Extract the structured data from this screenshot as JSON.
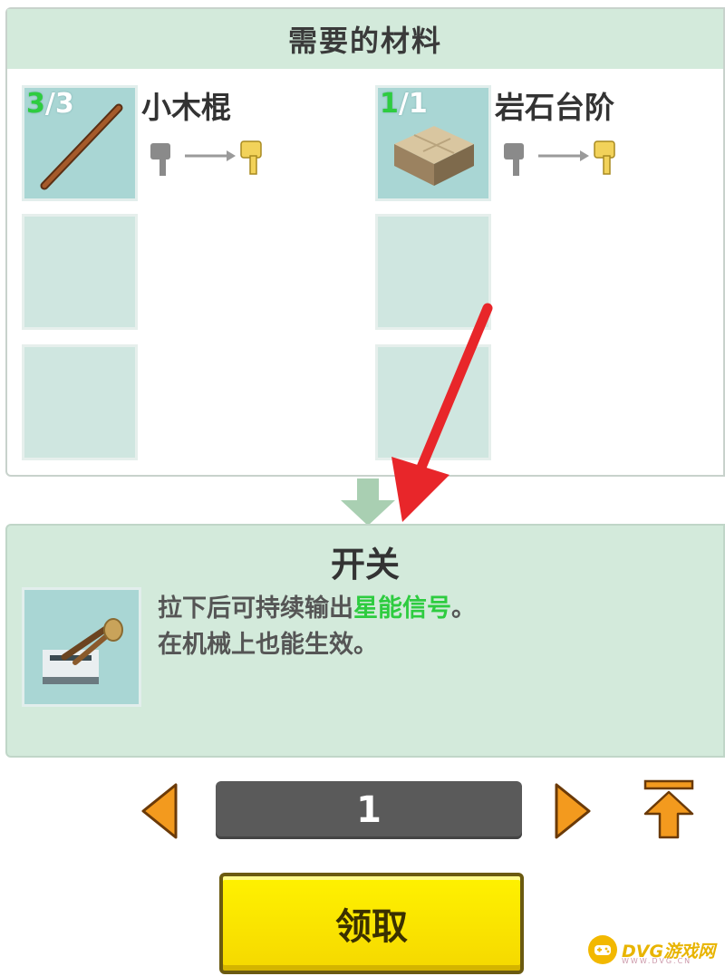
{
  "materials": {
    "header": "需要的材料",
    "items": [
      {
        "name": "小木棍",
        "count_have": "3",
        "count_sep_need": "/3",
        "icon": "wood-stick-icon"
      },
      {
        "name": "岩石台阶",
        "count_have": "1",
        "count_sep_need": "/1",
        "icon": "stone-slab-icon"
      }
    ]
  },
  "item": {
    "title": "开关",
    "icon": "lever-switch-icon",
    "desc_line1_prefix": "拉下后可持续输出",
    "desc_line1_highlight": "星能信号",
    "desc_line1_suffix": "。",
    "desc_line2": "在机械上也能生效。"
  },
  "pagination": {
    "page": "1"
  },
  "claim_button": {
    "label": "领取"
  },
  "watermark": {
    "text": "DVG游戏网",
    "sub": "WWW.DVG.CN"
  },
  "colors": {
    "panel_bg": "#d3eadb",
    "slot_bg": "#a9d6d4",
    "highlight_green": "#2ecc40",
    "arrow_orange": "#f39a1e",
    "button_yellow": "#fff200"
  }
}
